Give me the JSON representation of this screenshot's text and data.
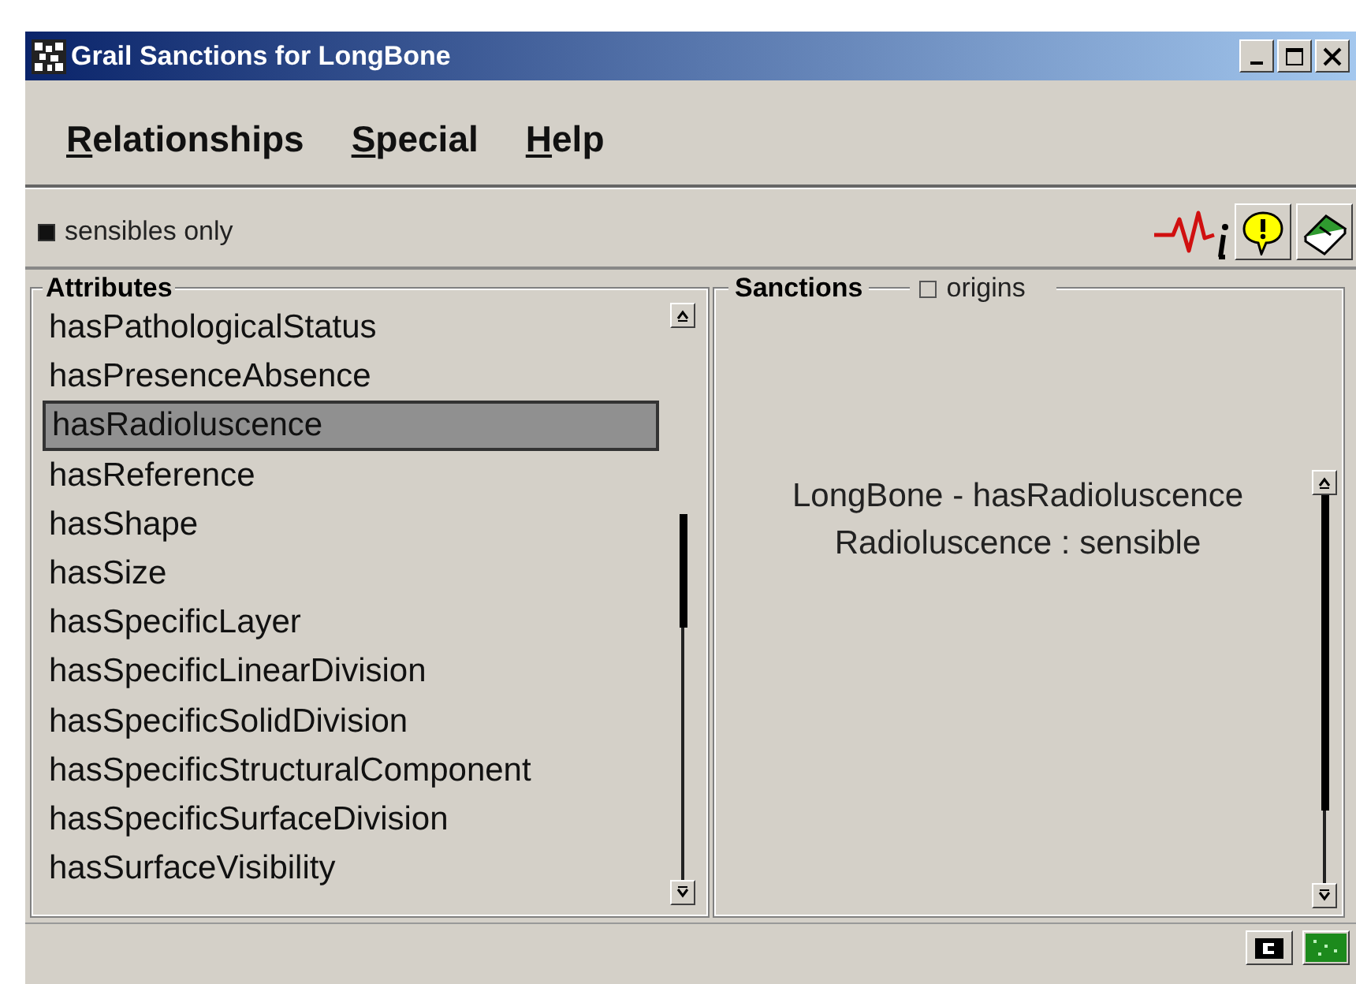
{
  "window": {
    "title": "Grail Sanctions for LongBone"
  },
  "menu": [
    {
      "parts": [
        {
          "text": "R",
          "underlined": true
        },
        {
          "text": "elationships",
          "underlined": false
        }
      ]
    },
    {
      "parts": [
        {
          "text": "S",
          "underlined": true
        },
        {
          "text": "pecial",
          "underlined": false
        }
      ]
    },
    {
      "parts": [
        {
          "text": "H",
          "underlined": true
        },
        {
          "text": "elp",
          "underlined": false
        }
      ]
    }
  ],
  "filter": {
    "label": "sensibles only",
    "checked": true
  },
  "attributes": {
    "title": "Attributes",
    "items": [
      {
        "label": "hasPathologicalStatus",
        "selected": false
      },
      {
        "label": "hasPresenceAbsence",
        "selected": false
      },
      {
        "label": "hasRadioluscence",
        "selected": true
      },
      {
        "label": "hasReference",
        "selected": false
      },
      {
        "label": "hasShape",
        "selected": false
      },
      {
        "label": "hasSize",
        "selected": false
      },
      {
        "label": "hasSpecificLayer",
        "selected": false
      },
      {
        "label": "hasSpecificLinearDivision",
        "selected": false
      },
      {
        "label": "hasSpecificSolidDivision",
        "selected": false
      },
      {
        "label": "hasSpecificStructuralComponent",
        "selected": false
      },
      {
        "label": "hasSpecificSurfaceDivision",
        "selected": false
      },
      {
        "label": "hasSurfaceVisibility",
        "selected": false
      }
    ]
  },
  "sanctions": {
    "title": "Sanctions",
    "origins": {
      "label": "origins",
      "checked": false
    },
    "lines": [
      "LongBone - hasRadioluscence",
      "Radioluscence : sensible"
    ]
  }
}
